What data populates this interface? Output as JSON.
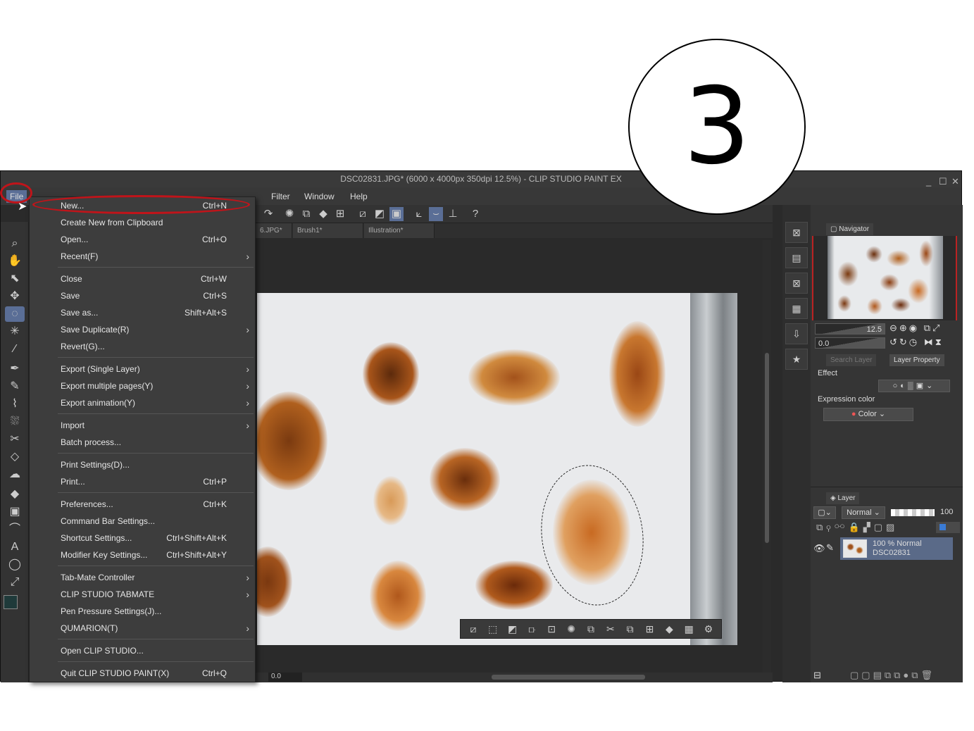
{
  "step_number": "3",
  "window": {
    "title": "DSC02831.JPG* (6000 x 4000px 350dpi 12.5%)  - CLIP STUDIO PAINT EX",
    "controls": [
      "_",
      "☐",
      "✕"
    ]
  },
  "menubar": {
    "file": "File",
    "filter": "Filter",
    "window": "Window",
    "help": "Help"
  },
  "tabs": [
    "6.JPG*",
    "Brush1*",
    "Illustration*"
  ],
  "file_menu": [
    {
      "label": "New...",
      "shortcut": "Ctrl+N"
    },
    {
      "label": "Create New from Clipboard"
    },
    {
      "label": "Open...",
      "shortcut": "Ctrl+O"
    },
    {
      "label": "Recent(F)",
      "submenu": true
    },
    {
      "sep": true
    },
    {
      "label": "Close",
      "shortcut": "Ctrl+W"
    },
    {
      "label": "Save",
      "shortcut": "Ctrl+S"
    },
    {
      "label": "Save as...",
      "shortcut": "Shift+Alt+S"
    },
    {
      "label": "Save Duplicate(R)",
      "submenu": true
    },
    {
      "label": "Revert(G)..."
    },
    {
      "sep": true
    },
    {
      "label": "Export (Single Layer)",
      "submenu": true
    },
    {
      "label": "Export multiple pages(Y)",
      "submenu": true
    },
    {
      "label": "Export animation(Y)",
      "submenu": true
    },
    {
      "sep": true
    },
    {
      "label": "Import",
      "submenu": true
    },
    {
      "label": "Batch process..."
    },
    {
      "sep": true
    },
    {
      "label": "Print Settings(D)..."
    },
    {
      "label": "Print...",
      "shortcut": "Ctrl+P"
    },
    {
      "sep": true
    },
    {
      "label": "Preferences...",
      "shortcut": "Ctrl+K"
    },
    {
      "label": "Command Bar Settings..."
    },
    {
      "label": "Shortcut Settings...",
      "shortcut": "Ctrl+Shift+Alt+K"
    },
    {
      "label": "Modifier Key Settings...",
      "shortcut": "Ctrl+Shift+Alt+Y"
    },
    {
      "sep": true
    },
    {
      "label": "Tab-Mate Controller",
      "submenu": true
    },
    {
      "label": "CLIP STUDIO TABMATE",
      "submenu": true
    },
    {
      "label": "Pen Pressure Settings(J)..."
    },
    {
      "label": "QUMARION(T)",
      "submenu": true
    },
    {
      "sep": true
    },
    {
      "label": "Open CLIP STUDIO..."
    },
    {
      "sep": true
    },
    {
      "label": "Quit CLIP STUDIO PAINT(X)",
      "shortcut": "Ctrl+Q"
    }
  ],
  "canvas_status": {
    "rotation": "0.0"
  },
  "navigator": {
    "tab": "Navigator",
    "zoom": "12.5",
    "rotation": "0.0"
  },
  "layer_property": {
    "tabs": [
      "Search Layer",
      "Layer Property"
    ],
    "effect_label": "Effect",
    "expression_color_label": "Expression color",
    "expression_color_value": "Color"
  },
  "layer_panel": {
    "tab": "Layer",
    "blend_mode": "Normal",
    "opacity": "100",
    "layers": [
      {
        "info": "100 % Normal",
        "name": "DSC02831"
      }
    ]
  },
  "colors": {
    "annotation_red": "#c0141a",
    "selected_layer": "#5a6a88",
    "accent_blue": "#3a7bd5"
  }
}
